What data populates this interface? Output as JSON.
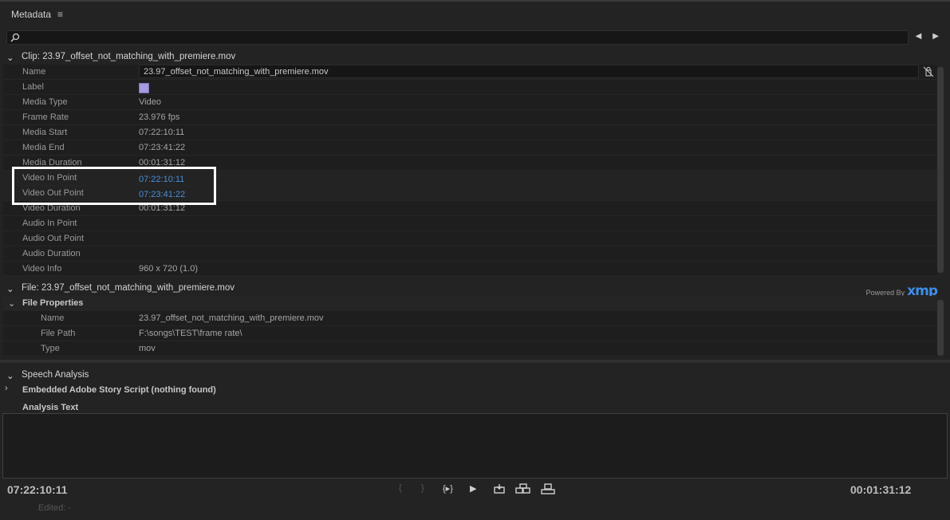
{
  "panel": {
    "title": "Metadata",
    "menu_icon": "hamburger-icon"
  },
  "search": {
    "placeholder": ""
  },
  "clip": {
    "header": "Clip: 23.97_offset_not_matching_with_premiere.mov",
    "rows": [
      {
        "label": "Name",
        "value": "23.97_offset_not_matching_with_premiere.mov"
      },
      {
        "label": "Label",
        "value": ""
      },
      {
        "label": "Media Type",
        "value": "Video"
      },
      {
        "label": "Frame Rate",
        "value": "23.976 fps"
      },
      {
        "label": "Media Start",
        "value": "07:22:10:11"
      },
      {
        "label": "Media End",
        "value": "07:23:41:22"
      },
      {
        "label": "Media Duration",
        "value": "00:01:31:12"
      },
      {
        "label": "Video In Point",
        "value": "07:22:10:11"
      },
      {
        "label": "Video Out Point",
        "value": "07:23:41:22"
      },
      {
        "label": "Video Duration",
        "value": "00:01:31:12"
      },
      {
        "label": "Audio In Point",
        "value": ""
      },
      {
        "label": "Audio Out Point",
        "value": ""
      },
      {
        "label": "Audio Duration",
        "value": ""
      },
      {
        "label": "Video Info",
        "value": "960 x 720 (1.0)"
      }
    ],
    "label_color": "#a69ae0"
  },
  "file": {
    "header": "File: 23.97_offset_not_matching_with_premiere.mov",
    "powered_by": "Powered By",
    "xmp": "xmp",
    "subsection": "File Properties",
    "rows": [
      {
        "label": "Name",
        "value": "23.97_offset_not_matching_with_premiere.mov"
      },
      {
        "label": "File Path",
        "value": "F:\\songs\\TEST\\frame rate\\"
      },
      {
        "label": "Type",
        "value": "mov"
      }
    ]
  },
  "speech": {
    "header": "Speech Analysis",
    "embedded": "Embedded Adobe Story Script (nothing found)",
    "analysis_text": "Analysis Text"
  },
  "footer": {
    "current_tc": "07:22:10:11",
    "duration_tc": "00:01:31:12",
    "edited": "Edited: -"
  },
  "colors": {
    "accent": "#4c8dd6",
    "xmp": "#3d8ee8",
    "highlight": "#ffffff"
  }
}
